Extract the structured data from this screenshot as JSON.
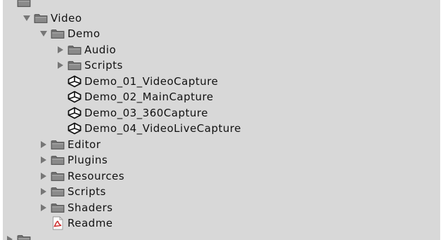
{
  "tree": {
    "rows": [
      {
        "label": "",
        "depth": 1,
        "fold": "none",
        "icon": "folder-icon"
      },
      {
        "label": "Video",
        "depth": 2,
        "fold": "expanded",
        "icon": "folder-icon"
      },
      {
        "label": "Demo",
        "depth": 3,
        "fold": "expanded",
        "icon": "folder-icon"
      },
      {
        "label": "Audio",
        "depth": 4,
        "fold": "collapsed",
        "icon": "folder-icon"
      },
      {
        "label": "Scripts",
        "depth": 4,
        "fold": "collapsed",
        "icon": "folder-icon"
      },
      {
        "label": "Demo_01_VideoCapture",
        "depth": 4,
        "fold": "none",
        "icon": "unity-scene-icon"
      },
      {
        "label": "Demo_02_MainCapture",
        "depth": 4,
        "fold": "none",
        "icon": "unity-scene-icon"
      },
      {
        "label": "Demo_03_360Capture",
        "depth": 4,
        "fold": "none",
        "icon": "unity-scene-icon"
      },
      {
        "label": "Demo_04_VideoLiveCapture",
        "depth": 4,
        "fold": "none",
        "icon": "unity-scene-icon"
      },
      {
        "label": "Editor",
        "depth": 3,
        "fold": "collapsed",
        "icon": "folder-icon"
      },
      {
        "label": "Plugins",
        "depth": 3,
        "fold": "collapsed",
        "icon": "folder-icon"
      },
      {
        "label": "Resources",
        "depth": 3,
        "fold": "collapsed",
        "icon": "folder-icon"
      },
      {
        "label": "Scripts",
        "depth": 3,
        "fold": "collapsed",
        "icon": "folder-icon"
      },
      {
        "label": "Shaders",
        "depth": 3,
        "fold": "collapsed",
        "icon": "folder-icon"
      },
      {
        "label": "Readme",
        "depth": 3,
        "fold": "none",
        "icon": "pdf-document-icon"
      },
      {
        "label": "",
        "depth": 1,
        "fold": "collapsed",
        "icon": "folder-icon"
      }
    ]
  },
  "colors": {
    "panel_background": "#d8d8d8",
    "folder": "#6f6f6f",
    "foldout_arrow": "#777777",
    "pdf_red": "#cc2a2a"
  }
}
